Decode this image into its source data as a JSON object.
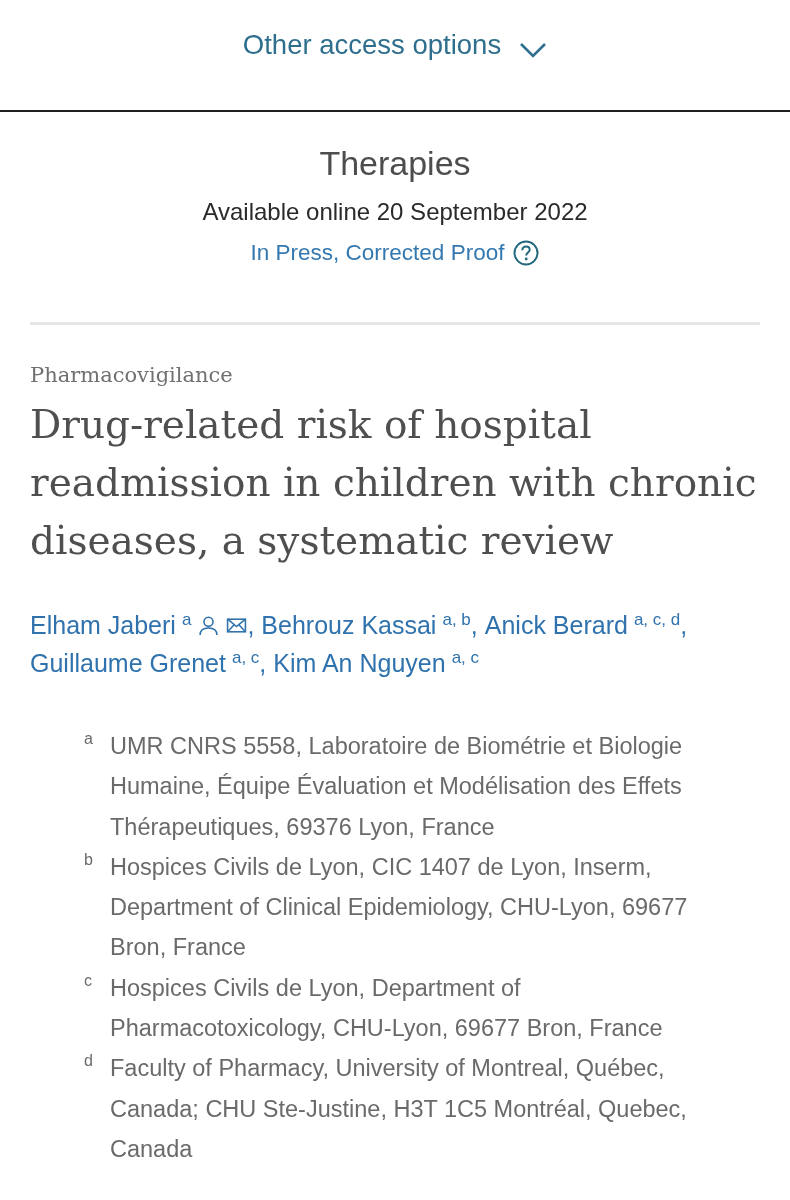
{
  "access_toggle": {
    "label": "Other access options",
    "expanded": false
  },
  "journal": {
    "title": "Therapies",
    "availability": "Available online 20 September 2022",
    "status": "In Press, Corrected Proof"
  },
  "article": {
    "section": "Pharmacovigilance",
    "title": "Drug-related risk of hospital readmission in children with chronic diseases, a systematic review",
    "authors": [
      {
        "name": "Elham Jaberi",
        "refs": "a",
        "corresponding": true,
        "separator": ","
      },
      {
        "name": "Behrouz Kassai",
        "refs": "a, b",
        "separator": ","
      },
      {
        "name": "Anick Berard",
        "refs": "a, c, d",
        "separator": ","
      },
      {
        "name": "Guillaume Grenet",
        "refs": "a, c",
        "separator": ","
      },
      {
        "name": "Kim An Nguyen",
        "refs": "a, c"
      }
    ],
    "affiliations": [
      {
        "label": "a",
        "text": "UMR CNRS 5558, Laboratoire de Biométrie et Biologie Humaine, Équipe Évaluation et Modélisation des Effets Thérapeutiques, 69376 Lyon, France"
      },
      {
        "label": "b",
        "text": "Hospices Civils de Lyon, CIC 1407 de Lyon, Inserm, Department of Clinical Epidemiology, CHU-Lyon, 69677 Bron, France"
      },
      {
        "label": "c",
        "text": "Hospices Civils de Lyon, Department of Pharmacotoxicology, CHU-Lyon, 69677 Bron, France"
      },
      {
        "label": "d",
        "text": "Faculty of Pharmacy, University of Montreal, Québec, Canada; CHU Ste-Justine, H3T 1C5 Montréal, Quebec, Canada"
      }
    ]
  }
}
